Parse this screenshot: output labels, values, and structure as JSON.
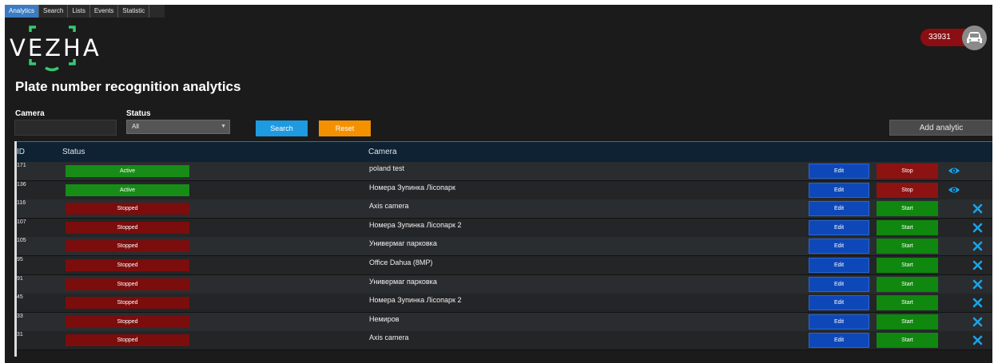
{
  "tabs": [
    {
      "label": "Analytics",
      "active": true
    },
    {
      "label": "Search",
      "active": false
    },
    {
      "label": "Lists",
      "active": false
    },
    {
      "label": "Events",
      "active": false
    },
    {
      "label": "Statistic",
      "active": false
    }
  ],
  "logo": {
    "text": "VEZHA"
  },
  "page_title": "Plate number recognition analytics",
  "filters": {
    "camera_label": "Camera",
    "camera_value": "",
    "status_label": "Status",
    "status_value": "All",
    "search_label": "Search",
    "reset_label": "Reset",
    "add_label": "Add analytic"
  },
  "counter": {
    "value": "33931",
    "icon": "car-icon"
  },
  "table": {
    "headers": {
      "id": "ID",
      "status": "Status",
      "camera": "Camera"
    },
    "rows": [
      {
        "id": "171",
        "status": "Active",
        "camera": "poland test",
        "edit": "Edit",
        "action": "Stop",
        "icon": "eye-icon"
      },
      {
        "id": "136",
        "status": "Active",
        "camera": "Номера Зупинка Лісопарк",
        "edit": "Edit",
        "action": "Stop",
        "icon": "eye-icon"
      },
      {
        "id": "116",
        "status": "Stopped",
        "camera": "Axis camera",
        "edit": "Edit",
        "action": "Start",
        "icon": "close-icon"
      },
      {
        "id": "107",
        "status": "Stopped",
        "camera": "Номера Зупинка Лісопарк 2",
        "edit": "Edit",
        "action": "Start",
        "icon": "close-icon"
      },
      {
        "id": "105",
        "status": "Stopped",
        "camera": "Универмаг парковка",
        "edit": "Edit",
        "action": "Start",
        "icon": "close-icon"
      },
      {
        "id": "95",
        "status": "Stopped",
        "camera": "Office Dahua (8MP)",
        "edit": "Edit",
        "action": "Start",
        "icon": "close-icon"
      },
      {
        "id": "91",
        "status": "Stopped",
        "camera": "Универмаг парковка",
        "edit": "Edit",
        "action": "Start",
        "icon": "close-icon"
      },
      {
        "id": "45",
        "status": "Stopped",
        "camera": "Номера Зупинка Лісопарк 2",
        "edit": "Edit",
        "action": "Start",
        "icon": "close-icon"
      },
      {
        "id": "33",
        "status": "Stopped",
        "camera": "Немиров",
        "edit": "Edit",
        "action": "Start",
        "icon": "close-icon"
      },
      {
        "id": "31",
        "status": "Stopped",
        "camera": "Axis camera",
        "edit": "Edit",
        "action": "Start",
        "icon": "close-icon"
      }
    ]
  },
  "colors": {
    "logo_accent": "#37c871",
    "active": "#178d17",
    "stopped": "#7c0d0d",
    "edit": "#0e48b8",
    "eye": "#1aa3e8",
    "close": "#1aa3e8"
  }
}
